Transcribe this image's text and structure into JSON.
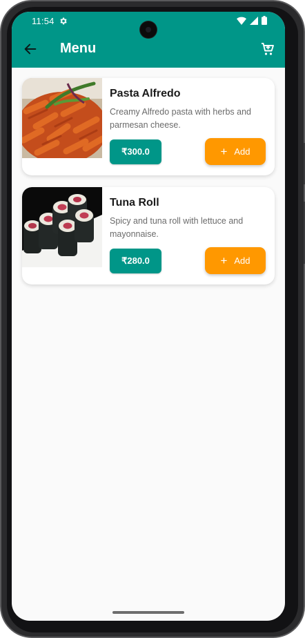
{
  "status_bar": {
    "time": "11:54"
  },
  "app_bar": {
    "title": "Menu"
  },
  "menu_items": [
    {
      "name": "Pasta Alfredo",
      "description": "Creamy Alfredo pasta with herbs and parmesan cheese.",
      "price": "₹300.0",
      "add_label": "Add"
    },
    {
      "name": "Tuna Roll",
      "description": "Spicy and tuna roll with lettuce and mayonnaise.",
      "price": "₹280.0",
      "add_label": "Add"
    }
  ],
  "colors": {
    "primary": "#009688",
    "accent": "#ff9800",
    "background": "#fafafa"
  },
  "icons": {
    "back": "arrow-left-icon",
    "cart": "cart-icon",
    "settings": "gear-icon",
    "wifi": "wifi-icon",
    "signal": "signal-icon",
    "battery": "battery-icon"
  }
}
